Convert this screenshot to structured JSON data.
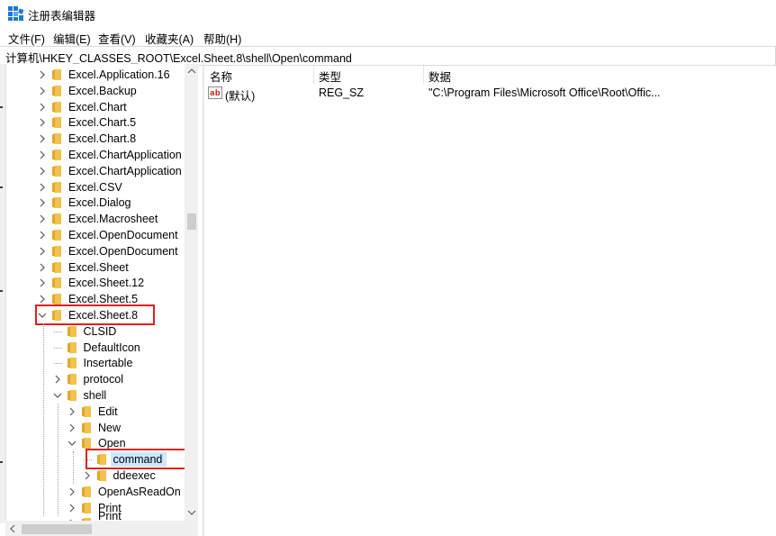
{
  "window": {
    "title": "注册表编辑器"
  },
  "menu": [
    "文件(F)",
    "编辑(E)",
    "查看(V)",
    "收藏夹(A)",
    "帮助(H)"
  ],
  "address": "计算机\\HKEY_CLASSES_ROOT\\Excel.Sheet.8\\shell\\Open\\command",
  "tree": [
    {
      "label": "Excel.Application.16",
      "indent": 0,
      "expander": "right"
    },
    {
      "label": "Excel.Backup",
      "indent": 0,
      "expander": "right"
    },
    {
      "label": "Excel.Chart",
      "indent": 0,
      "expander": "right"
    },
    {
      "label": "Excel.Chart.5",
      "indent": 0,
      "expander": "right"
    },
    {
      "label": "Excel.Chart.8",
      "indent": 0,
      "expander": "right"
    },
    {
      "label": "Excel.ChartApplication",
      "indent": 0,
      "expander": "right"
    },
    {
      "label": "Excel.ChartApplication",
      "indent": 0,
      "expander": "right"
    },
    {
      "label": "Excel.CSV",
      "indent": 0,
      "expander": "right"
    },
    {
      "label": "Excel.Dialog",
      "indent": 0,
      "expander": "right"
    },
    {
      "label": "Excel.Macrosheet",
      "indent": 0,
      "expander": "right"
    },
    {
      "label": "Excel.OpenDocument",
      "indent": 0,
      "expander": "right"
    },
    {
      "label": "Excel.OpenDocument",
      "indent": 0,
      "expander": "right"
    },
    {
      "label": "Excel.Sheet",
      "indent": 0,
      "expander": "right"
    },
    {
      "label": "Excel.Sheet.12",
      "indent": 0,
      "expander": "right"
    },
    {
      "label": "Excel.Sheet.5",
      "indent": 0,
      "expander": "right"
    },
    {
      "label": "Excel.Sheet.8",
      "indent": 0,
      "expander": "down",
      "highlight": true
    },
    {
      "label": "CLSID",
      "indent": 1,
      "expander": "none"
    },
    {
      "label": "DefaultIcon",
      "indent": 1,
      "expander": "none"
    },
    {
      "label": "Insertable",
      "indent": 1,
      "expander": "none"
    },
    {
      "label": "protocol",
      "indent": 1,
      "expander": "right"
    },
    {
      "label": "shell",
      "indent": 1,
      "expander": "down"
    },
    {
      "label": "Edit",
      "indent": 2,
      "expander": "right"
    },
    {
      "label": "New",
      "indent": 2,
      "expander": "right"
    },
    {
      "label": "Open",
      "indent": 2,
      "expander": "down"
    },
    {
      "label": "command",
      "indent": 3,
      "expander": "none",
      "selected": true,
      "highlight": true
    },
    {
      "label": "ddeexec",
      "indent": 3,
      "expander": "right"
    },
    {
      "label": "OpenAsReadOn",
      "indent": 2,
      "expander": "right"
    },
    {
      "label": "Print",
      "indent": 2,
      "expander": "right"
    },
    {
      "label": "Print",
      "indent": 2,
      "expander": "right",
      "cut": true
    }
  ],
  "list": {
    "columns": [
      "名称",
      "类型",
      "数据"
    ],
    "rows": [
      {
        "name": "(默认)",
        "type": "REG_SZ",
        "data": "\"C:\\Program Files\\Microsoft Office\\Root\\Offic..."
      }
    ]
  },
  "colors": {
    "folder": "#f2c14e",
    "highlight_box": "#e02020",
    "selection": "#cce8ff",
    "icon_blue": "#1e78d7"
  }
}
